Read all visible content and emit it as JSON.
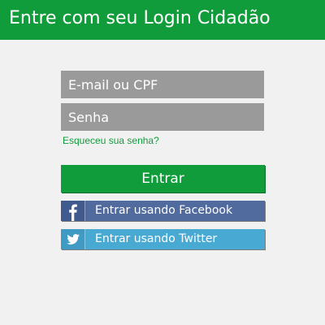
{
  "header": {
    "title": "Entre com seu Login Cidadão"
  },
  "form": {
    "email_placeholder": "E-mail ou CPF",
    "password_placeholder": "Senha",
    "forgot_password": "Esqueceu sua senha?",
    "submit_label": "Entrar"
  },
  "social": {
    "facebook_label": "Entrar usando Facebook",
    "facebook_icon": "facebook-icon",
    "twitter_label": "Entrar usando Twitter",
    "twitter_icon": "twitter-icon"
  },
  "colors": {
    "brand_green": "#119c3c",
    "field_gray": "#9a9a9a",
    "background": "#f1f1f1",
    "facebook_blue": "#526b9f",
    "twitter_blue": "#48a9d3"
  }
}
